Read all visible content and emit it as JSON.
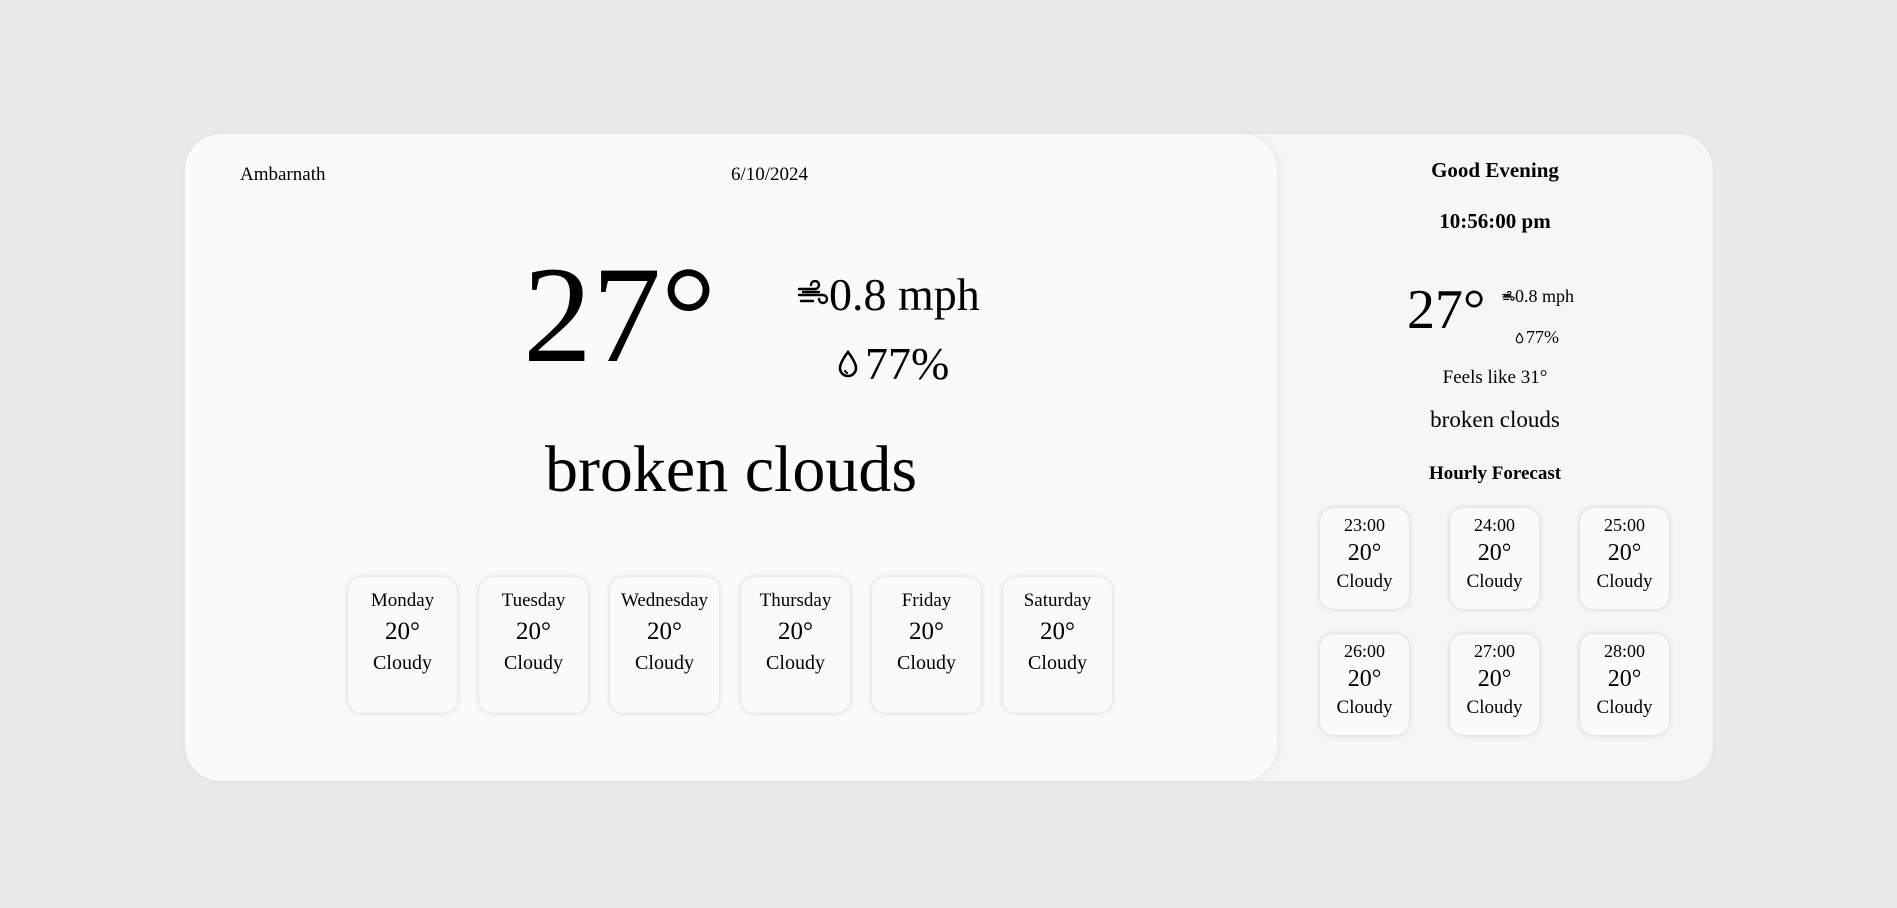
{
  "main": {
    "city": "Ambarnath",
    "date": "6/10/2024",
    "temperature": "27°",
    "wind": "0.8 mph",
    "humidity": "77%",
    "description": "broken clouds",
    "wind_icon": "wind-icon",
    "humidity_icon": "droplet-icon",
    "daily": [
      {
        "day": "Monday",
        "temp": "20°",
        "desc": "Cloudy"
      },
      {
        "day": "Tuesday",
        "temp": "20°",
        "desc": "Cloudy"
      },
      {
        "day": "Wednesday",
        "temp": "20°",
        "desc": "Cloudy"
      },
      {
        "day": "Thursday",
        "temp": "20°",
        "desc": "Cloudy"
      },
      {
        "day": "Friday",
        "temp": "20°",
        "desc": "Cloudy"
      },
      {
        "day": "Saturday",
        "temp": "20°",
        "desc": "Cloudy"
      }
    ]
  },
  "side": {
    "greeting": "Good Evening",
    "time": "10:56:00 pm",
    "temperature": "27°",
    "wind": "0.8 mph",
    "humidity": "77%",
    "feels_like": "Feels like 31°",
    "description": "broken clouds",
    "hourly_title": "Hourly Forecast",
    "hourly": [
      {
        "time": "23:00",
        "temp": "20°",
        "desc": "Cloudy"
      },
      {
        "time": "24:00",
        "temp": "20°",
        "desc": "Cloudy"
      },
      {
        "time": "25:00",
        "temp": "20°",
        "desc": "Cloudy"
      },
      {
        "time": "26:00",
        "temp": "20°",
        "desc": "Cloudy"
      },
      {
        "time": "27:00",
        "temp": "20°",
        "desc": "Cloudy"
      },
      {
        "time": "28:00",
        "temp": "20°",
        "desc": "Cloudy"
      }
    ]
  },
  "colors": {
    "background": "#e9e9e9",
    "card": "#fafafa",
    "side_panel": "#f6f6f6",
    "text": "#000000"
  }
}
